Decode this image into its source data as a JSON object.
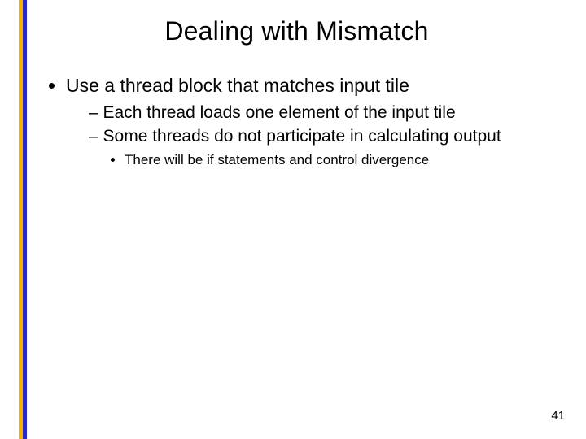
{
  "title": "Dealing with Mismatch",
  "bullets": {
    "l1_0": "Use a thread block that matches input tile",
    "l2_0": "Each thread loads one element of the input tile",
    "l2_1": "Some threads do not participate in calculating output",
    "l3_0": "There will be if statements and control divergence"
  },
  "page_number": "41",
  "accent": {
    "yellow": "#f2b200",
    "blue": "#2828c8"
  }
}
